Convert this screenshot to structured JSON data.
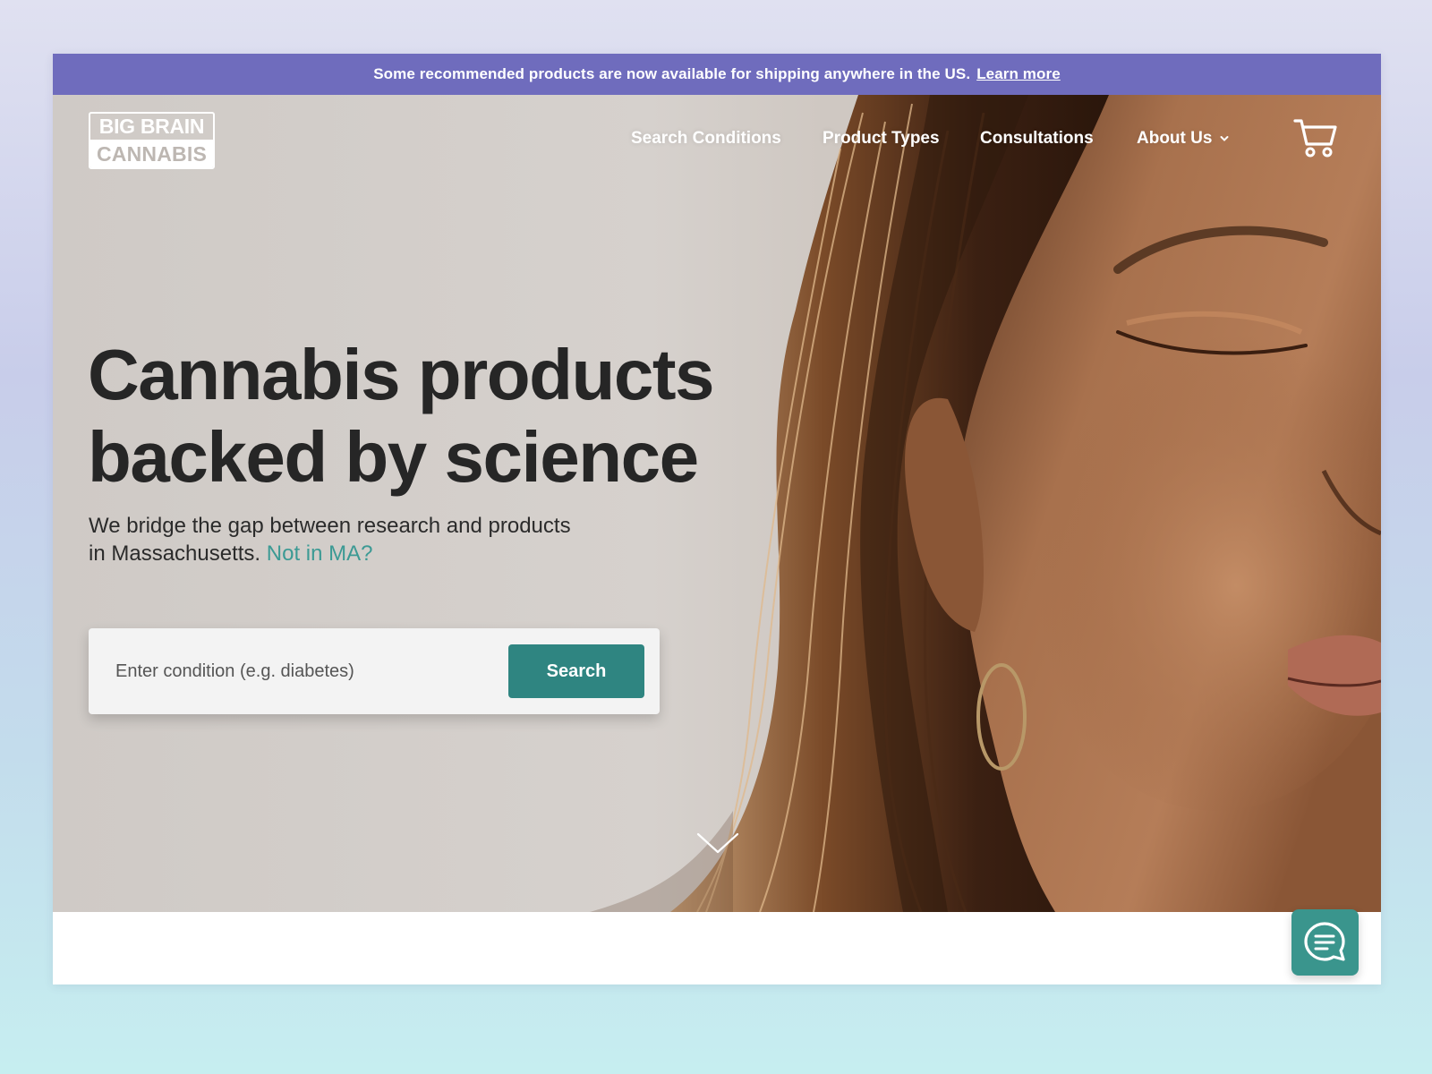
{
  "announcement": {
    "text": "Some recommended products are now available for shipping anywhere in the US.",
    "link": "Learn more",
    "background": "#6f6cbd"
  },
  "brand": {
    "line1": "BIG BRAIN",
    "line2": "CANNABIS"
  },
  "nav": {
    "items": [
      {
        "label": "Search Conditions"
      },
      {
        "label": "Product Types"
      },
      {
        "label": "Consultations"
      },
      {
        "label": "About Us",
        "has_dropdown": true
      }
    ],
    "cart_icon": "cart-icon"
  },
  "hero": {
    "headline_line1": "Cannabis products",
    "headline_line2": "backed by science",
    "subtext": "We bridge the gap between research and products in Massachusetts.",
    "subtext_link": "Not in MA?",
    "search_placeholder": "Enter condition (e.g. diabetes)",
    "search_button": "Search",
    "scroll_icon": "chevron-down-icon"
  },
  "chat": {
    "icon": "chat-icon"
  },
  "colors": {
    "accent": "#2f8581",
    "link": "#3c9a94",
    "chat": "#3a958d"
  }
}
